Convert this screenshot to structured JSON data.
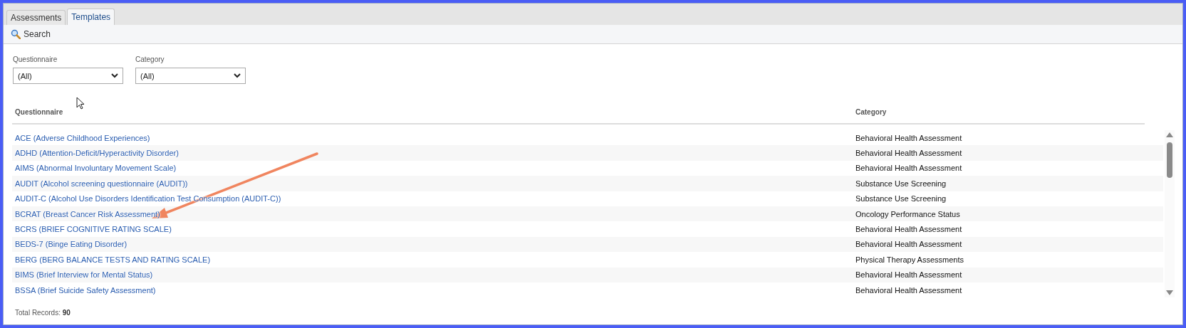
{
  "tabs": [
    {
      "label": "Assessments",
      "selected": false
    },
    {
      "label": "Templates",
      "selected": true
    }
  ],
  "toolbar": {
    "search": "Search"
  },
  "filters": [
    {
      "label": "Questionnaire",
      "value": "(All)"
    },
    {
      "label": "Category",
      "value": "(All)"
    }
  ],
  "table": {
    "columns": [
      "Questionnaire",
      "Category"
    ],
    "rows": [
      {
        "questionnaire": "ACE (Adverse Childhood Experiences)",
        "category": "Behavioral Health Assessment"
      },
      {
        "questionnaire": "ADHD (Attention-Deficit/Hyperactivity Disorder)",
        "category": "Behavioral Health Assessment"
      },
      {
        "questionnaire": "AIMS (Abnormal Involuntary Movement Scale)",
        "category": "Behavioral Health Assessment"
      },
      {
        "questionnaire": "AUDIT (Alcohol screening questionnaire (AUDIT))",
        "category": "Substance Use Screening"
      },
      {
        "questionnaire": "AUDIT-C (Alcohol Use Disorders Identification Test Consumption (AUDIT-C))",
        "category": "Substance Use Screening"
      },
      {
        "questionnaire": "BCRAT (Breast Cancer Risk Assessment)",
        "category": "Oncology Performance Status"
      },
      {
        "questionnaire": "BCRS (BRIEF COGNITIVE RATING SCALE)",
        "category": "Behavioral Health Assessment"
      },
      {
        "questionnaire": "BEDS-7 (Binge Eating Disorder)",
        "category": "Behavioral Health Assessment"
      },
      {
        "questionnaire": "BERG (BERG BALANCE TESTS AND RATING SCALE)",
        "category": "Physical Therapy Assessments"
      },
      {
        "questionnaire": "BIMS (Brief Interview for Mental Status)",
        "category": "Behavioral Health Assessment"
      },
      {
        "questionnaire": "BSSA (Brief Suicide Safety Assessment)",
        "category": "Behavioral Health Assessment"
      }
    ]
  },
  "footer": {
    "total": "Total Records: **90**"
  }
}
